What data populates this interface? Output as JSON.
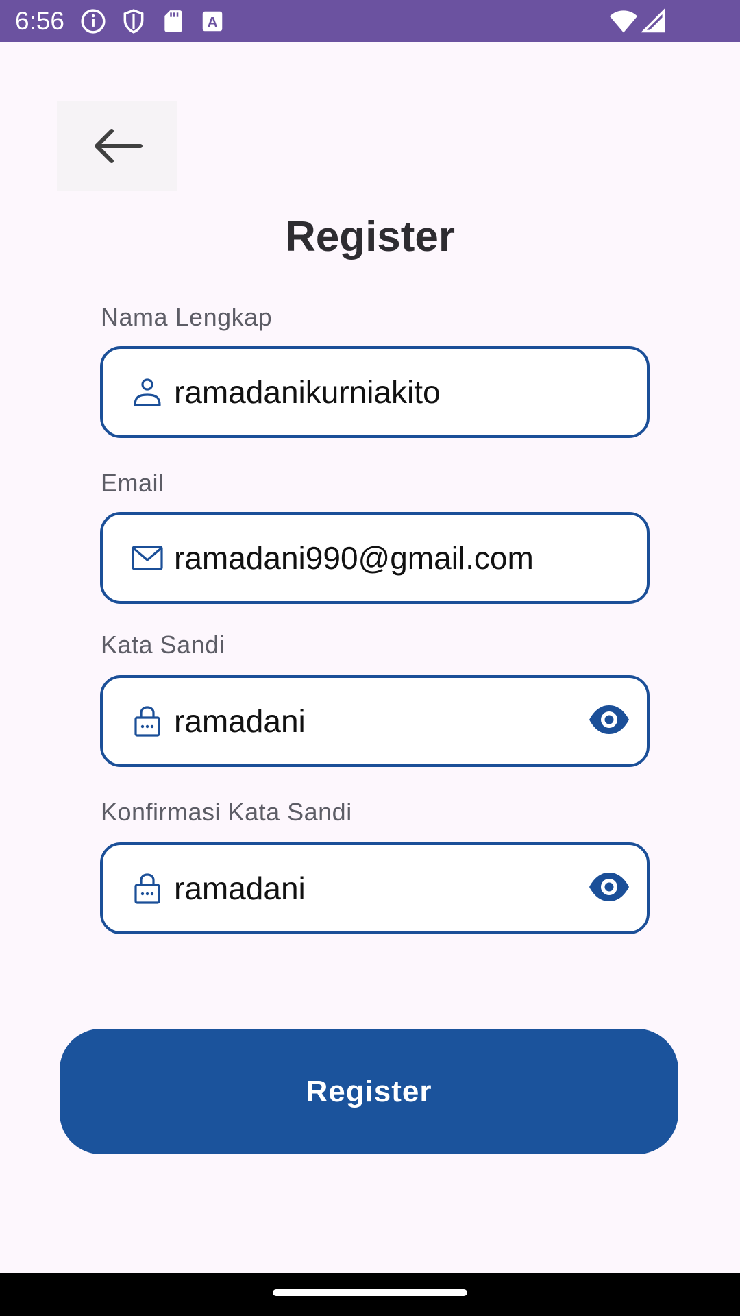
{
  "status_bar": {
    "time": "6:56",
    "left_icons": [
      "info-icon",
      "shield-icon",
      "sd-card-icon",
      "a-icon"
    ],
    "right_icons": [
      "wifi-icon",
      "signal-icon"
    ],
    "color": "#6B52A0"
  },
  "header": {
    "back_icon": "arrow-left-icon",
    "title": "Register"
  },
  "form": {
    "full_name": {
      "label": "Nama Lengkap",
      "value": "ramadanikurniakito",
      "icon": "user-icon"
    },
    "email": {
      "label": "Email",
      "value": "ramadani990@gmail.com",
      "icon": "mail-icon"
    },
    "password": {
      "label": "Kata Sandi",
      "value": "ramadani",
      "icon": "lock-icon",
      "toggle_icon": "eye-icon"
    },
    "confirm_password": {
      "label": "Konfirmasi Kata Sandi",
      "value": "ramadani",
      "icon": "lock-icon",
      "toggle_icon": "eye-icon"
    }
  },
  "actions": {
    "register_label": "Register"
  },
  "colors": {
    "accent": "#1B539C",
    "field_border": "#1B4F98",
    "background": "#FDF7FD"
  }
}
